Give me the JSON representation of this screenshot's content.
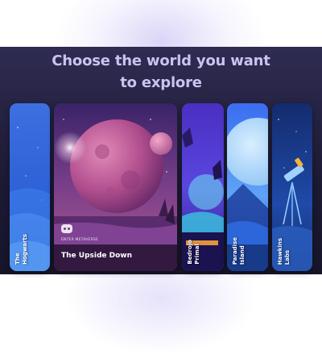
{
  "heading": {
    "line1": "Choose the world you want",
    "line2": "to explore"
  },
  "cards": [
    {
      "id": "hogwarts",
      "label_line1": "The",
      "label_line2": "Hogwarts",
      "interactive": true
    },
    {
      "id": "upside-down",
      "badge": "ENTER METAVERSE",
      "title": "The Upside Down",
      "icon": "vr-headset-icon",
      "expanded": true
    },
    {
      "id": "bedrojo",
      "label_line1": "Bedrojo",
      "label_line2": "Primal"
    },
    {
      "id": "paradise",
      "label_line1": "Paradise",
      "label_line2": "Island"
    },
    {
      "id": "hawkins",
      "label_line1": "Hawkins",
      "label_line2": "Labs"
    }
  ],
  "colors": {
    "panel": "#24223f",
    "heading": "#c9c3f2",
    "accent": "#b34fa0"
  }
}
